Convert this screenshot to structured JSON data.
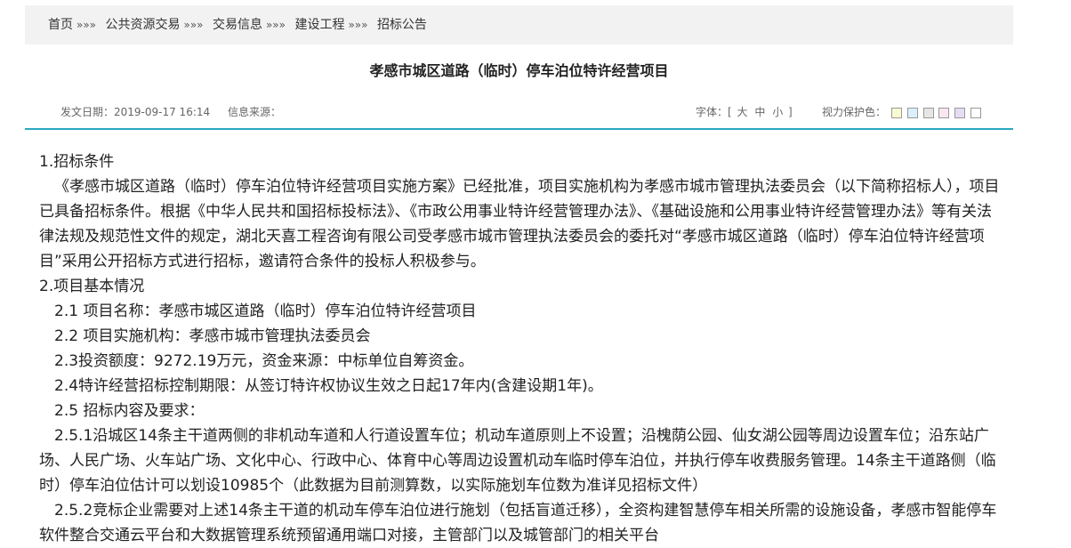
{
  "breadcrumb": {
    "items": [
      "首页",
      "公共资源交易",
      "交易信息",
      "建设工程",
      "招标公告"
    ],
    "separator": "»»»"
  },
  "article": {
    "title": "孝感市城区道路（临时）停车泊位特许经营项目",
    "publish_label": "发文日期：2019-09-17 16:14",
    "source_label": "信息来源：",
    "font_label": "字体：[",
    "font_options": [
      "大",
      "中",
      "小"
    ],
    "font_close": "]",
    "eye_label": "视力保护色：",
    "eye_colors": [
      "#fafad2",
      "#dcefff",
      "#e6e6e6",
      "#fae6f0",
      "#e6dcf5",
      "#ffffff"
    ]
  },
  "content": {
    "p1": "1.招标条件",
    "p2": "《孝感市城区道路（临时）停车泊位特许经营项目实施方案》已经批准，项目实施机构为孝感市城市管理执法委员会（以下简称招标人），项目已具备招标条件。根据《中华人民共和国招标投标法》、《市政公用事业特许经营管理办法》、《基础设施和公用事业特许经营管理办法》等有关法律法规及规范性文件的规定，湖北天喜工程咨询有限公司受孝感市城市管理执法委员会的委托对“孝感市城区道路（临时）停车泊位特许经营项目”采用公开招标方式进行招标，邀请符合条件的投标人积极参与。",
    "p3": "2.项目基本情况",
    "p4": "2.1 项目名称：孝感市城区道路（临时）停车泊位特许经营项目",
    "p5": "2.2 项目实施机构：孝感市城市管理执法委员会",
    "p6": "2.3投资额度：9272.19万元，资金来源：中标单位自筹资金。",
    "p7": "2.4特许经营招标控制期限：从签订特许权协议生效之日起17年内(含建设期1年)。",
    "p8": "2.5 招标内容及要求：",
    "p9": "2.5.1沿城区14条主干道两侧的非机动车道和人行道设置车位；机动车道原则上不设置；沿槐荫公园、仙女湖公园等周边设置车位；沿东站广场、人民广场、火车站广场、文化中心、行政中心、体育中心等周边设置机动车临时停车泊位，并执行停车收费服务管理。14条主干道路侧（临时）停车泊位估计可以划设10985个（此数据为目前测算数，以实际施划车位数为准详见招标文件）",
    "p10": "2.5.2竞标企业需要对上述14条主干道的机动车停车泊位进行施划（包括盲道迁移），全资构建智慧停车相关所需的设施设备，孝感市智能停车软件整合交通云平台和大数据管理系统预留通用端口对接，主管部门以及城管部门的相关平台"
  }
}
